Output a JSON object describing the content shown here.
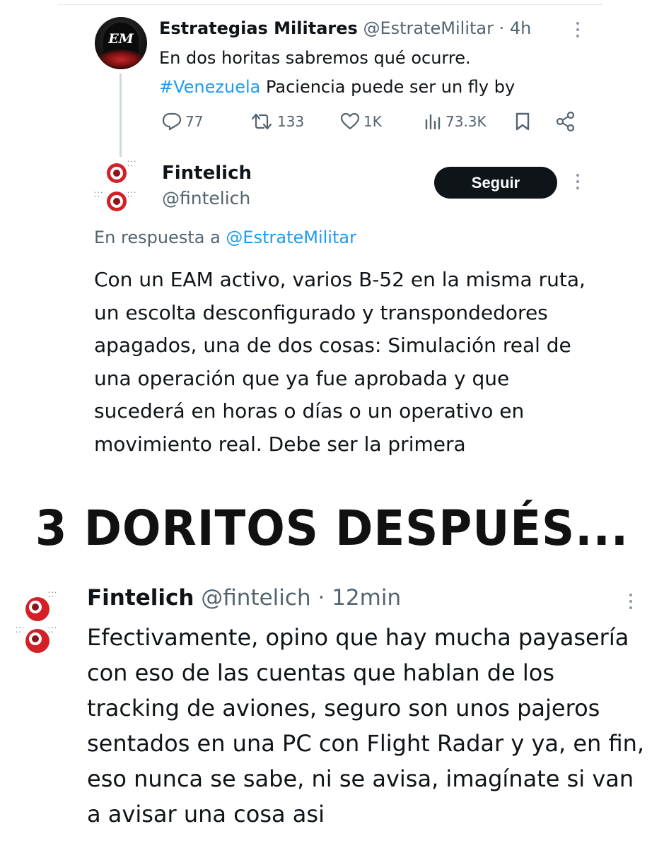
{
  "tweet1": {
    "avatar_text": "EM",
    "name": "Estrategias Militares",
    "handle": "@EstrateMilitar",
    "separator": "·",
    "time": "4h",
    "text_line1": "En dos horitas sabremos qué ocurre.",
    "hashtag": "#Venezuela",
    "text_line2_rest": " Paciencia puede ser un fly by",
    "replies": "77",
    "retweets": "133",
    "likes": "1K",
    "views": "73.3K"
  },
  "tweet2": {
    "name": "Fintelich",
    "handle": "@fintelich",
    "follow_label": "Seguir",
    "reply_prefix": "En respuesta a ",
    "reply_mention": "@EstrateMilitar",
    "body": "Con un EAM activo, varios B-52 en la misma ruta, un escolta desconfigurado y transpondedores apagados, una de dos cosas: Simulación real de una operación que ya fue aprobada y que sucederá en horas o días o un operativo en movimiento real. Debe ser la primera"
  },
  "headline": "3 DORITOS DESPUÉS...",
  "tweet3": {
    "name": "Fintelich",
    "handle": "@fintelich",
    "separator": "·",
    "time": "12min",
    "body": "Efectivamente, opino que hay mucha payasería con eso de las cuentas que hablan de los tracking de aviones, seguro son unos pajeros sentados en una PC con Flight Radar y ya, en fin, eso nunca se sabe, ni se avisa, imagínate si van a avisar una cosa asi"
  },
  "colors": {
    "link": "#1d9bf0",
    "secondary_text": "#536471",
    "target_red": "#d32027",
    "follow_button": "#0f1419"
  }
}
